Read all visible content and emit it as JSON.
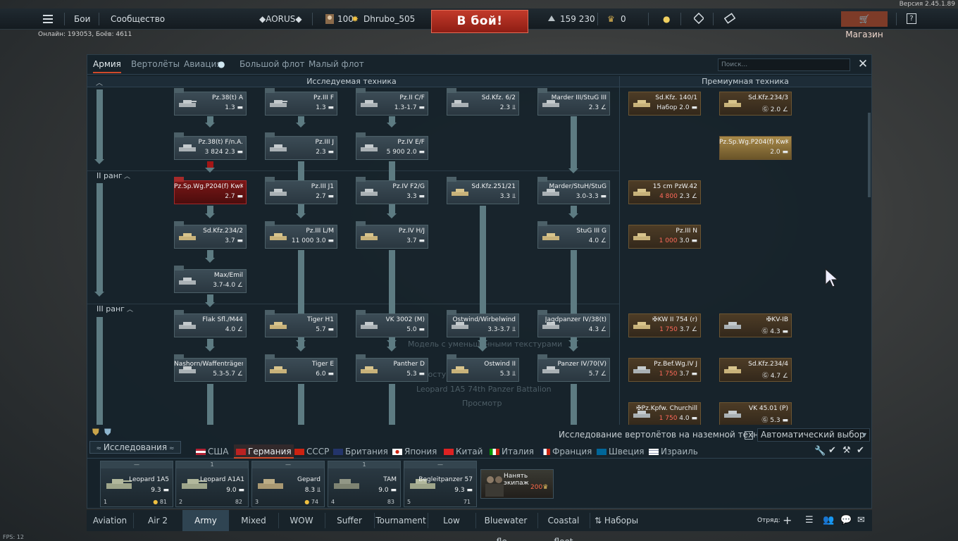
{
  "version": "Версия 2.45.1.89",
  "topbar": {
    "battles": "Бои",
    "community": "Сообщество",
    "clan_tag": "◆AORUS◆",
    "level": "100",
    "nickname": "Dhrubo_505",
    "battle_button": "В бой!",
    "silver": "159 230",
    "gold": "0",
    "shop": "Магазин",
    "help": "?"
  },
  "online": "Онлайн: 193053, Боёв: 4611",
  "panel": {
    "tabs": [
      "Армия",
      "Вертолёты",
      "Авиация",
      "Большой флот",
      "Малый флот"
    ],
    "active_tab": "Армия",
    "search_placeholder": "Поиск...",
    "researchable_header": "Исследуемая техника",
    "premium_header": "Премиумная техника",
    "rank2": "II ранг",
    "rank3": "III ранг",
    "ghost_lines": [
      "Модель с уменьшенными текстурами",
      "Доступно для покупки",
      "Leopard 1A5 74th Panzer Battalion",
      "Просмотр"
    ],
    "tree": [
      {
        "name": "Pz.38(t) A",
        "br": "1.3"
      },
      {
        "name": "Pz.III F",
        "br": "1.3"
      },
      {
        "name": "Pz.II C/F",
        "br": "1.3-1.7"
      },
      {
        "name": "Sd.Kfz. 6/2",
        "br": "2.3"
      },
      {
        "name": "Marder III/StuG III",
        "br": "2.3"
      },
      {
        "name": "Pz.38(t) F/n.A.",
        "cost": "3 824",
        "br": "2.3"
      },
      {
        "name": "Pz.III J",
        "br": "2.3"
      },
      {
        "name": "Pz.IV E/F",
        "cost": "5 900",
        "br": "2.0"
      },
      {
        "name": "Pz.Sp.Wg.P204(f) KwK",
        "br": "2.7"
      },
      {
        "name": "Pz.III J1",
        "br": "2.7"
      },
      {
        "name": "Pz.IV F2/G",
        "br": "3.3"
      },
      {
        "name": "Sd.Kfz.251/21",
        "br": "3.3"
      },
      {
        "name": "Marder/StuH/StuG",
        "br": "3.0-3.3"
      },
      {
        "name": "Sd.Kfz.234/2",
        "br": "3.7"
      },
      {
        "name": "Pz.III L/M",
        "cost": "11 000",
        "br": "3.0"
      },
      {
        "name": "Pz.IV H/J",
        "br": "3.7"
      },
      {
        "name": "StuG III G",
        "br": "4.0"
      },
      {
        "name": "Max/Emil",
        "br": "3.7-4.0"
      },
      {
        "name": "Flak Sfl./M44",
        "br": "4.0"
      },
      {
        "name": "Tiger H1",
        "br": "5.7"
      },
      {
        "name": "VK 3002 (M)",
        "br": "5.0"
      },
      {
        "name": "Ostwind/Wirbelwind",
        "br": "3.3-3.7"
      },
      {
        "name": "Jagdpanzer IV/38(t)",
        "br": "4.3"
      },
      {
        "name": "Nashorn/Waffenträger",
        "br": "5.3-5.7"
      },
      {
        "name": "Tiger E",
        "br": "6.0"
      },
      {
        "name": "Panther D",
        "br": "5.3"
      },
      {
        "name": "Ostwind II",
        "br": "5.3"
      },
      {
        "name": "Panzer IV/70(V)",
        "br": "5.7"
      }
    ],
    "premium": [
      {
        "name": "Sd.Kfz. 140/1",
        "cost": "Набор",
        "br": "2.0"
      },
      {
        "name": "Sd.Kfz.234/3",
        "br": "2.0"
      },
      {
        "name": "Pz.Sp.Wg.P204(f) KwK",
        "br": "2.0"
      },
      {
        "name": "15 cm PzW.42",
        "cost": "4 800",
        "br": "2.3"
      },
      {
        "name": "Pz.III N",
        "cost": "1 000",
        "br": "3.0"
      },
      {
        "name": "✠KW II 754 (r)",
        "cost": "1 750",
        "br": "3.7"
      },
      {
        "name": "✠KV-IB",
        "br": "4.3"
      },
      {
        "name": "Pz.Bef.Wg.IV J",
        "cost": "1 750",
        "br": "3.7"
      },
      {
        "name": "Sd.Kfz.234/4",
        "br": "4.7"
      },
      {
        "name": "✠Pz.Kpfw. Churchill",
        "cost": "1 750",
        "br": "4.0"
      },
      {
        "name": "VK 45.01 (P)",
        "br": "5.3"
      }
    ],
    "heli_research": "Исследование вертолётов на наземной технике",
    "auto_select": "Автоматический выбор",
    "research_button": "Исследования",
    "nations": [
      "США",
      "Германия",
      "СССР",
      "Британия",
      "Япония",
      "Китай",
      "Италия",
      "Франция",
      "Швеция",
      "Израиль"
    ],
    "active_nation": "Германия"
  },
  "crew": [
    {
      "head": "—",
      "name": "Leopard 1A5",
      "br": "9.3",
      "slot": "1",
      "extra": "81"
    },
    {
      "head": "1",
      "name": "Leopard A1A1",
      "br": "9.0",
      "slot": "2",
      "extra": "82"
    },
    {
      "head": "—",
      "name": "Gepard",
      "br": "8.3",
      "slot": "3",
      "extra": "74"
    },
    {
      "head": "1",
      "name": "TAM",
      "br": "9.0",
      "slot": "4",
      "extra": "83"
    },
    {
      "head": "—",
      "name": "Begleitpanzer 57",
      "br": "9.3",
      "slot": "5",
      "extra": "71"
    }
  ],
  "hire_crew": {
    "label": "Нанять экипаж",
    "cost": "200"
  },
  "bottom_tabs": [
    "Aviation",
    "Air 2",
    "Army",
    "Mixed",
    "WOW",
    "Suffer",
    "Tournament",
    "Low",
    "Bluewater fle...",
    "Coastal fleet",
    "Наборы"
  ],
  "active_bottom_tab": "Army",
  "squad": "Отряд:",
  "fps": "FPS: 12",
  "colors": {
    "accent": "#d04a2a",
    "premium": "#6c5532",
    "link": "#5d7b82"
  }
}
